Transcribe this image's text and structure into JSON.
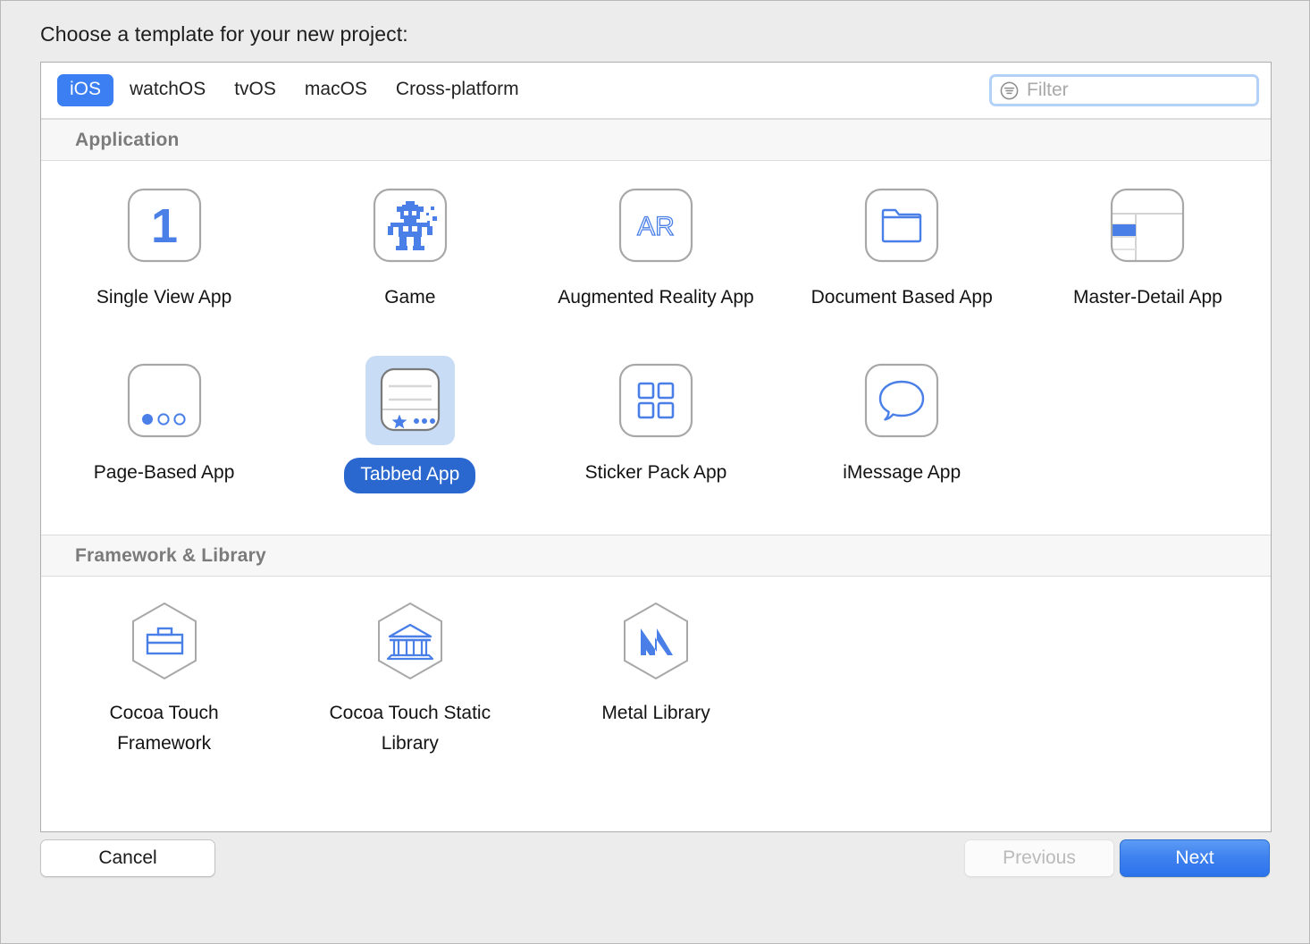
{
  "dialog": {
    "title": "Choose a template for your new project:"
  },
  "toolbar": {
    "platforms": [
      {
        "label": "iOS",
        "active": true
      },
      {
        "label": "watchOS",
        "active": false
      },
      {
        "label": "tvOS",
        "active": false
      },
      {
        "label": "macOS",
        "active": false
      },
      {
        "label": "Cross-platform",
        "active": false
      }
    ],
    "filter": {
      "placeholder": "Filter",
      "value": "",
      "icon": "filter-icon"
    }
  },
  "sections": [
    {
      "header": "Application",
      "rows": [
        [
          {
            "label": "Single View App",
            "icon": "single-view-icon",
            "selected": false
          },
          {
            "label": "Game",
            "icon": "game-robot-icon",
            "selected": false
          },
          {
            "label": "Augmented Reality App",
            "icon": "augmented-reality-icon",
            "selected": false
          },
          {
            "label": "Document Based App",
            "icon": "document-folder-icon",
            "selected": false
          },
          {
            "label": "Master-Detail App",
            "icon": "master-detail-icon",
            "selected": false
          }
        ],
        [
          {
            "label": "Page-Based App",
            "icon": "page-based-icon",
            "selected": false
          },
          {
            "label": "Tabbed App",
            "icon": "tabbed-app-icon",
            "selected": true
          },
          {
            "label": "Sticker Pack App",
            "icon": "sticker-pack-icon",
            "selected": false
          },
          {
            "label": "iMessage App",
            "icon": "imessage-bubble-icon",
            "selected": false
          }
        ]
      ]
    },
    {
      "header": "Framework & Library",
      "rows": [
        [
          {
            "label": "Cocoa Touch Framework",
            "icon": "briefcase-hexagon-icon",
            "selected": false
          },
          {
            "label": "Cocoa Touch Static Library",
            "icon": "library-building-hexagon-icon",
            "selected": false
          },
          {
            "label": "Metal Library",
            "icon": "metal-hexagon-icon",
            "selected": false
          }
        ]
      ]
    }
  ],
  "footer": {
    "cancel": "Cancel",
    "previous": "Previous",
    "next": "Next"
  },
  "colors": {
    "accent_blue": "#3b7ff2",
    "selected_pill": "#2a68cf",
    "selection_highlight": "#c9dcf5",
    "icon_blue": "#4a7fe8",
    "icon_outline_gray": "#a8a8a8",
    "section_header_bg": "#f7f7f7",
    "section_header_text": "#7b7b7b",
    "window_bg": "#ececec"
  }
}
